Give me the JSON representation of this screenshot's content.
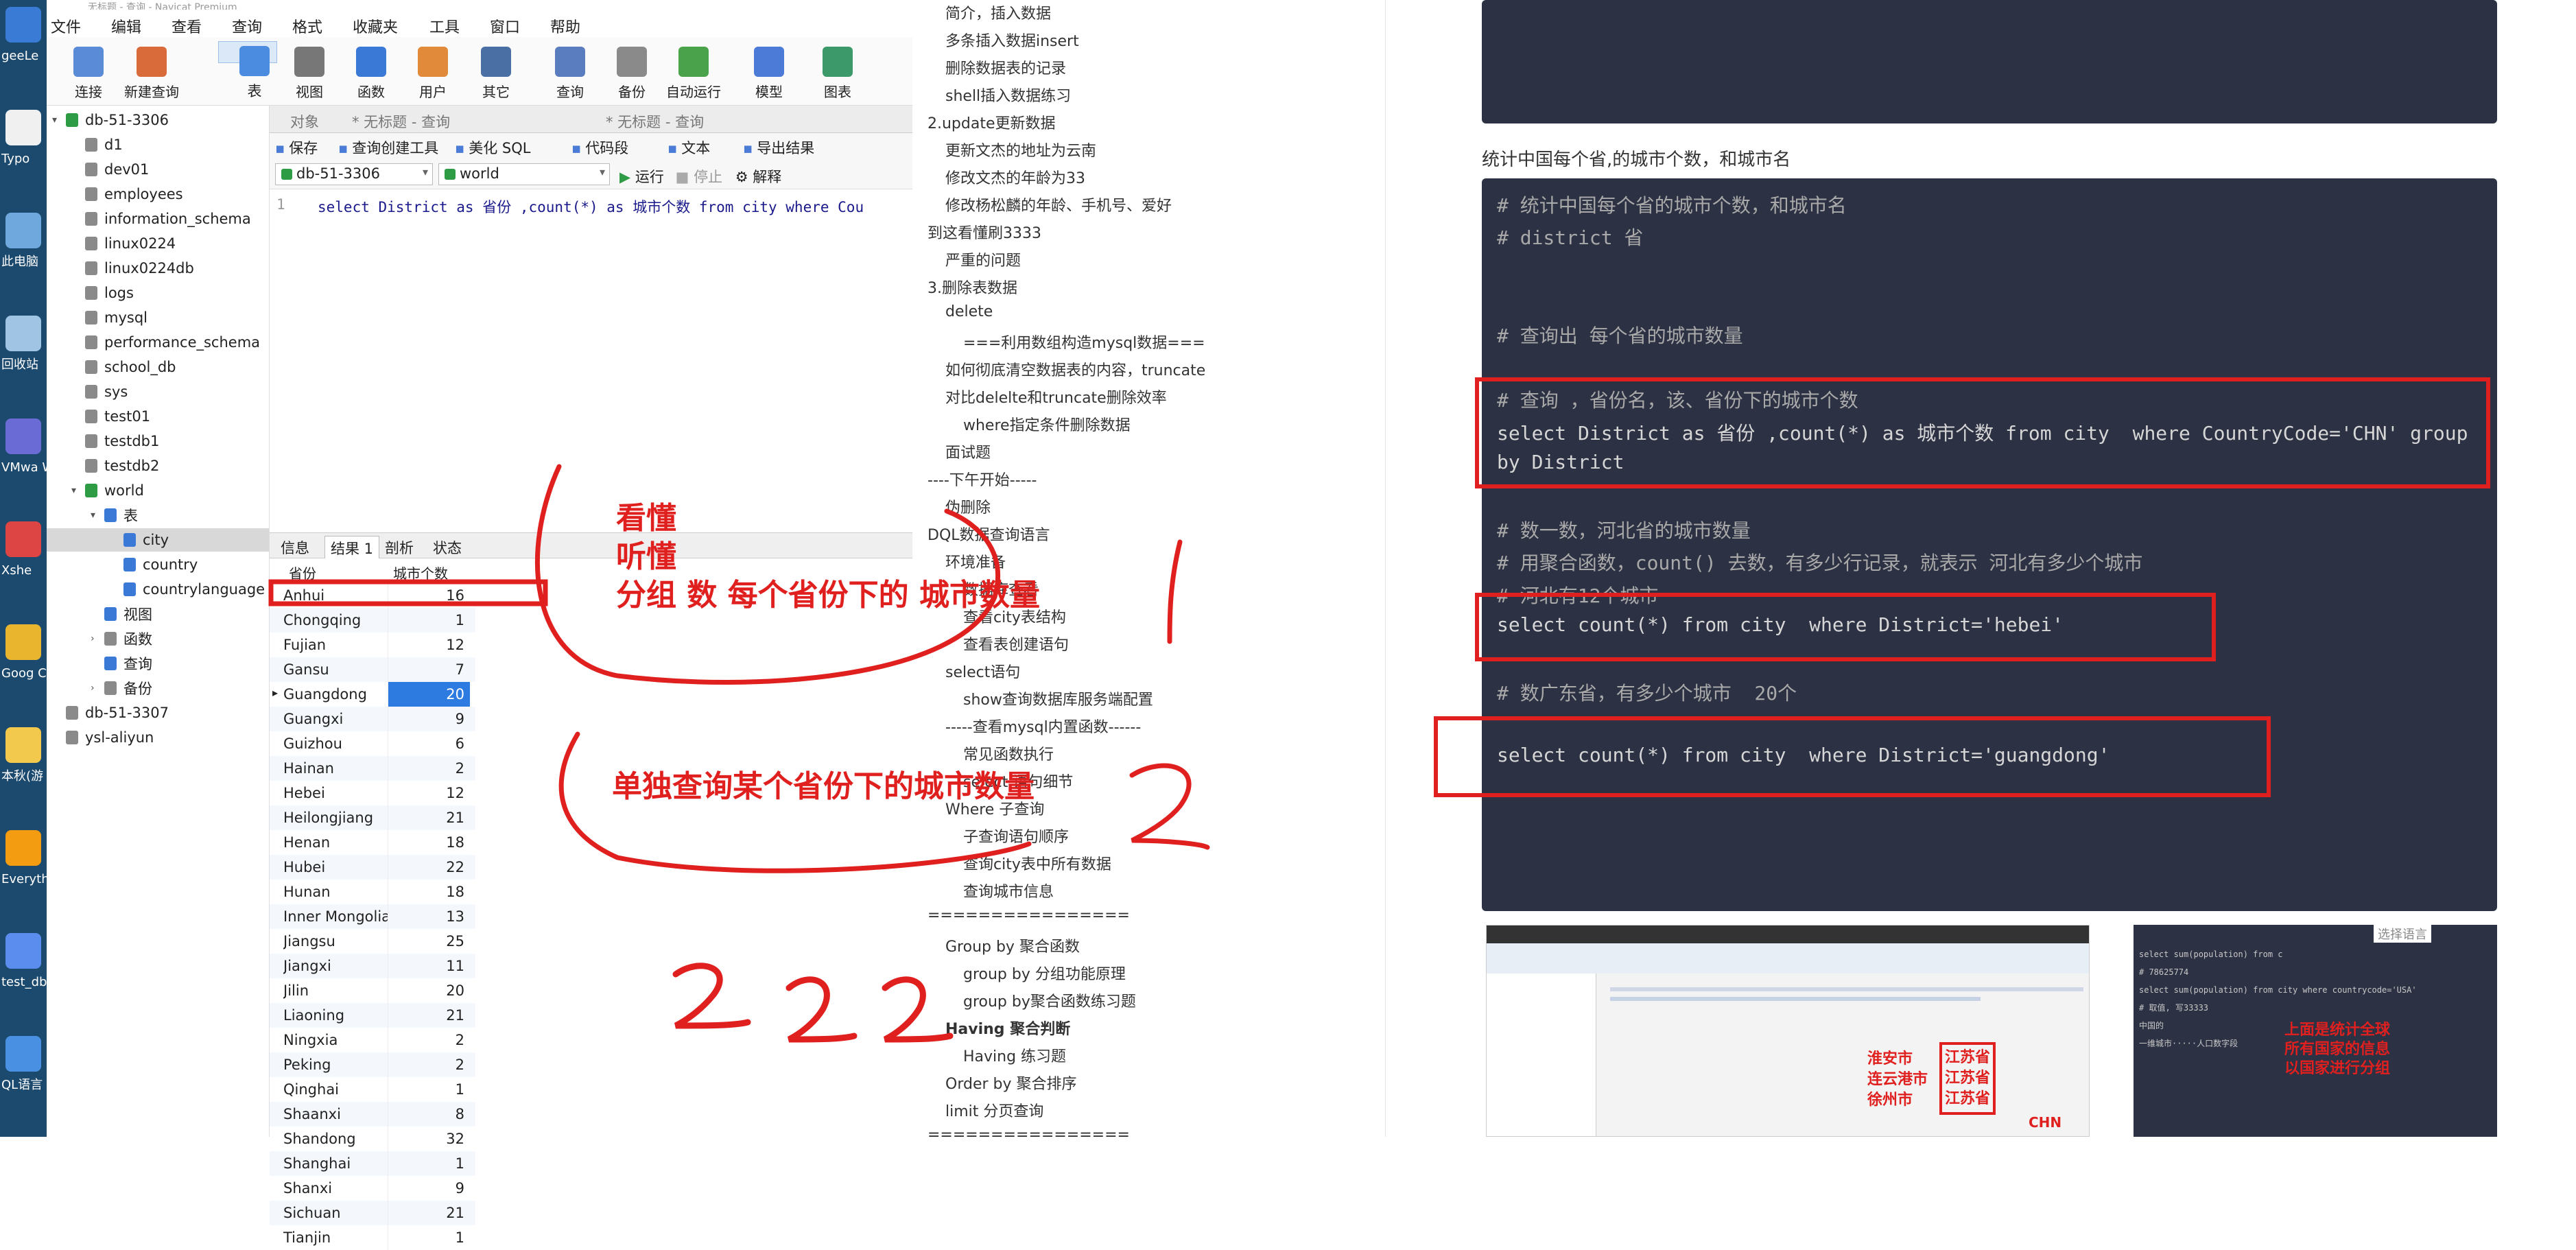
{
  "window": {
    "title": "无标题 - 查询 - Navicat Premium"
  },
  "desktop": {
    "icons": [
      {
        "label": "geeLe",
        "color": "#3a7bd5"
      },
      {
        "label": "Typo",
        "color": "#f0f0f0"
      },
      {
        "label": "此电脑",
        "color": "#6fa8dc"
      },
      {
        "label": "回收站",
        "color": "#a0c4e4"
      },
      {
        "label": "VMwa Works",
        "color": "#6b6bd6"
      },
      {
        "label": "Xshe",
        "color": "#d44"
      },
      {
        "label": "Goog Chrom",
        "color": "#e9b52f"
      },
      {
        "label": "本秋(游 享软件)",
        "color": "#f2c94c"
      },
      {
        "label": "Everyth",
        "color": "#f39c12"
      },
      {
        "label": "test_db",
        "color": "#5b8def"
      },
      {
        "label": "QL语言",
        "color": "#4a90e2"
      }
    ]
  },
  "menu": [
    "文件",
    "编辑",
    "查看",
    "查询",
    "格式",
    "收藏夹",
    "工具",
    "窗口",
    "帮助"
  ],
  "toolbar": [
    {
      "label": "连接",
      "color": "#5a8bd6"
    },
    {
      "label": "新建查询",
      "color": "#d96b3a"
    },
    {
      "label": "表",
      "color": "#4b8be0",
      "selected": true
    },
    {
      "label": "视图",
      "color": "#777"
    },
    {
      "label": "函数",
      "color": "#3a7ad6"
    },
    {
      "label": "用户",
      "color": "#e08a3a"
    },
    {
      "label": "其它",
      "color": "#4a6fa5"
    },
    {
      "label": "查询",
      "color": "#5a7dbf"
    },
    {
      "label": "备份",
      "color": "#8a8a8a"
    },
    {
      "label": "自动运行",
      "color": "#4aa34a"
    },
    {
      "label": "模型",
      "color": "#4b7bd6"
    },
    {
      "label": "图表",
      "color": "#3c9a6a"
    }
  ],
  "tree": {
    "items": [
      {
        "label": "db-51-3306",
        "kind": "conn",
        "level": 0,
        "arrow": "▾"
      },
      {
        "label": "d1",
        "kind": "db",
        "level": 1
      },
      {
        "label": "dev01",
        "kind": "db",
        "level": 1
      },
      {
        "label": "employees",
        "kind": "db",
        "level": 1
      },
      {
        "label": "information_schema",
        "kind": "db",
        "level": 1
      },
      {
        "label": "linux0224",
        "kind": "db",
        "level": 1
      },
      {
        "label": "linux0224db",
        "kind": "db",
        "level": 1
      },
      {
        "label": "logs",
        "kind": "db",
        "level": 1
      },
      {
        "label": "mysql",
        "kind": "db",
        "level": 1
      },
      {
        "label": "performance_schema",
        "kind": "db",
        "level": 1
      },
      {
        "label": "school_db",
        "kind": "db",
        "level": 1
      },
      {
        "label": "sys",
        "kind": "db",
        "level": 1
      },
      {
        "label": "test01",
        "kind": "db",
        "level": 1
      },
      {
        "label": "testdb1",
        "kind": "db",
        "level": 1
      },
      {
        "label": "testdb2",
        "kind": "db",
        "level": 1
      },
      {
        "label": "world",
        "kind": "conn",
        "level": 1,
        "arrow": "▾"
      },
      {
        "label": "表",
        "kind": "tbl",
        "level": 2,
        "arrow": "▾"
      },
      {
        "label": "city",
        "kind": "tbl",
        "level": 3,
        "highlight": true
      },
      {
        "label": "country",
        "kind": "tbl",
        "level": 3
      },
      {
        "label": "countrylanguage",
        "kind": "tbl",
        "level": 3
      },
      {
        "label": "视图",
        "kind": "tbl",
        "level": 2
      },
      {
        "label": "函数",
        "kind": "db",
        "level": 2,
        "arrow": "›"
      },
      {
        "label": "查询",
        "kind": "tbl",
        "level": 2
      },
      {
        "label": "备份",
        "kind": "db",
        "level": 2,
        "arrow": "›"
      },
      {
        "label": "db-51-3307",
        "kind": "db",
        "level": 0
      },
      {
        "label": "ysl-aliyun",
        "kind": "db",
        "level": 0
      }
    ]
  },
  "query": {
    "tabs": [
      "对象",
      "* 无标题 - 查询",
      "* 无标题 - 查询"
    ],
    "tools": [
      "保存",
      "查询创建工具",
      "美化 SQL",
      "代码段",
      "文本",
      "导出结果"
    ],
    "connection": "db-51-3306",
    "database": "world",
    "run": "运行",
    "stop": "停止",
    "explain": "解释",
    "line_no": "1",
    "sql": "select District as 省份 ,count(*) as 城市个数 from city  where Cou"
  },
  "results": {
    "tabs": [
      "信息",
      "结果 1",
      "剖析",
      "状态"
    ],
    "columns": [
      "省份",
      "城市个数"
    ],
    "rows": [
      [
        "Anhui",
        "16"
      ],
      [
        "Chongqing",
        "1"
      ],
      [
        "Fujian",
        "12"
      ],
      [
        "Gansu",
        "7"
      ],
      [
        "Guangdong",
        "20"
      ],
      [
        "Guangxi",
        "9"
      ],
      [
        "Guizhou",
        "6"
      ],
      [
        "Hainan",
        "2"
      ],
      [
        "Hebei",
        "12"
      ],
      [
        "Heilongjiang",
        "21"
      ],
      [
        "Henan",
        "18"
      ],
      [
        "Hubei",
        "22"
      ],
      [
        "Hunan",
        "18"
      ],
      [
        "Inner Mongolia",
        "13"
      ],
      [
        "Jiangsu",
        "25"
      ],
      [
        "Jiangxi",
        "11"
      ],
      [
        "Jilin",
        "20"
      ],
      [
        "Liaoning",
        "21"
      ],
      [
        "Ningxia",
        "2"
      ],
      [
        "Peking",
        "2"
      ],
      [
        "Qinghai",
        "1"
      ],
      [
        "Shaanxi",
        "8"
      ],
      [
        "Shandong",
        "32"
      ],
      [
        "Shanghai",
        "1"
      ],
      [
        "Shanxi",
        "9"
      ],
      [
        "Sichuan",
        "21"
      ],
      [
        "Tianjin",
        "1"
      ]
    ]
  },
  "annotations": {
    "left_lines": [
      "看懂",
      "听懂",
      "分组 数 每个省份下的 城市数量"
    ],
    "left_bottom": "单独查询某个省份下的城市数量",
    "digits_big": "2",
    "digits_row": "2 2 2",
    "red": "#e0201f"
  },
  "notes": [
    {
      "t": "简介，插入数据",
      "lvl": 1
    },
    {
      "t": "多条插入数据insert",
      "lvl": 1
    },
    {
      "t": "删除数据表的记录",
      "lvl": 1
    },
    {
      "t": "shell插入数据练习",
      "lvl": 1
    },
    {
      "t": "2.update更新数据",
      "lvl": 0
    },
    {
      "t": "更新文杰的地址为云南",
      "lvl": 1
    },
    {
      "t": "修改文杰的年龄为33",
      "lvl": 1
    },
    {
      "t": "修改杨松麟的年龄、手机号、爱好",
      "lvl": 1
    },
    {
      "t": "到这看懂刷3333",
      "lvl": 0
    },
    {
      "t": "严重的问题",
      "lvl": 1
    },
    {
      "t": "3.删除表数据",
      "lvl": 0
    },
    {
      "t": "delete",
      "lvl": 1
    },
    {
      "t": "===利用数组构造mysql数据===",
      "lvl": 2
    },
    {
      "t": "如何彻底清空数据表的内容，truncate",
      "lvl": 1
    },
    {
      "t": "对比delelte和truncate删除效率",
      "lvl": 1
    },
    {
      "t": "where指定条件删除数据",
      "lvl": 2
    },
    {
      "t": "面试题",
      "lvl": 1
    },
    {
      "t": "----下午开始-----",
      "lvl": 0
    },
    {
      "t": "伪删除",
      "lvl": 1
    },
    {
      "t": "DQL数据查询语言",
      "lvl": 0
    },
    {
      "t": "环境准备",
      "lvl": 1
    },
    {
      "t": "数据库查看",
      "lvl": 2
    },
    {
      "t": "查看city表结构",
      "lvl": 2
    },
    {
      "t": "查看表创建语句",
      "lvl": 2
    },
    {
      "t": "select语句",
      "lvl": 1
    },
    {
      "t": "show查询数据库服务端配置",
      "lvl": 2
    },
    {
      "t": "-----查看mysql内置函数------",
      "lvl": 1
    },
    {
      "t": "常见函数执行",
      "lvl": 2
    },
    {
      "t": "select 语句细节",
      "lvl": 2
    },
    {
      "t": "Where 子查询",
      "lvl": 1
    },
    {
      "t": "子查询语句顺序",
      "lvl": 2
    },
    {
      "t": "查询city表中所有数据",
      "lvl": 2
    },
    {
      "t": "查询城市信息",
      "lvl": 2
    },
    {
      "t": "================",
      "lvl": 0
    },
    {
      "t": "Group by 聚合函数",
      "lvl": 1
    },
    {
      "t": "group by 分组功能原理",
      "lvl": 2
    },
    {
      "t": "group by聚合函数练习题",
      "lvl": 2
    },
    {
      "t": "Having 聚合判断",
      "lvl": 1,
      "bold": true
    },
    {
      "t": "Having 练习题",
      "lvl": 2
    },
    {
      "t": "Order by 聚合排序",
      "lvl": 1
    },
    {
      "t": "limit 分页查询",
      "lvl": 1
    },
    {
      "t": "================",
      "lvl": 0
    }
  ],
  "doc": {
    "heading": "统计中国每个省,的城市个数，和城市名",
    "block1": [
      {
        "t": "# 统计中国每个省的城市个数，和城市名",
        "cm": true
      },
      {
        "t": "# district 省",
        "cm": true
      },
      {
        "t": "",
        "cm": true
      },
      {
        "t": "",
        "cm": true
      },
      {
        "t": "# 查询出 每个省的城市数量",
        "cm": true
      },
      {
        "t": "",
        "cm": true
      },
      {
        "t": "# 查询 ，省份名，该、省份下的城市个数",
        "cm": true
      },
      {
        "t": "select District as 省份 ,count(*) as 城市个数 from city  where CountryCode='CHN' group",
        "cm": false
      },
      {
        "t": "by District",
        "cm": false
      },
      {
        "t": "",
        "cm": true
      },
      {
        "t": "# 数一数，河北省的城市数量",
        "cm": true
      },
      {
        "t": "# 用聚合函数，count() 去数，有多少行记录，就表示 河北有多少个城市",
        "cm": true
      },
      {
        "t": "# 河北有12个城市",
        "cm": true
      },
      {
        "t": "select count(*) from city  where District='hebei'",
        "cm": false
      },
      {
        "t": "",
        "cm": true
      },
      {
        "t": "# 数广东省，有多少个城市  20个",
        "cm": true
      },
      {
        "t": "",
        "cm": true
      },
      {
        "t": "select count(*) from city  where District='guangdong'",
        "cm": false
      }
    ],
    "thumb_right": {
      "top_label": "选择语言",
      "code": [
        "select sum(population) from c",
        "# 78625774",
        "select sum(population) from city where  countrycode='USA'",
        "",
        "# 取值, 写33333",
        "",
        "",
        "中国的",
        "一维城市·····人口数字段"
      ],
      "note": [
        "上面是统计全球",
        "所有国家的信息",
        "以国家进行分组"
      ]
    },
    "thumb_left": {
      "cities": [
        "淮安市",
        "连云港市",
        "徐州市"
      ],
      "provs": [
        "江苏省",
        "江苏省",
        "江苏省"
      ],
      "chn": "CHN"
    }
  }
}
